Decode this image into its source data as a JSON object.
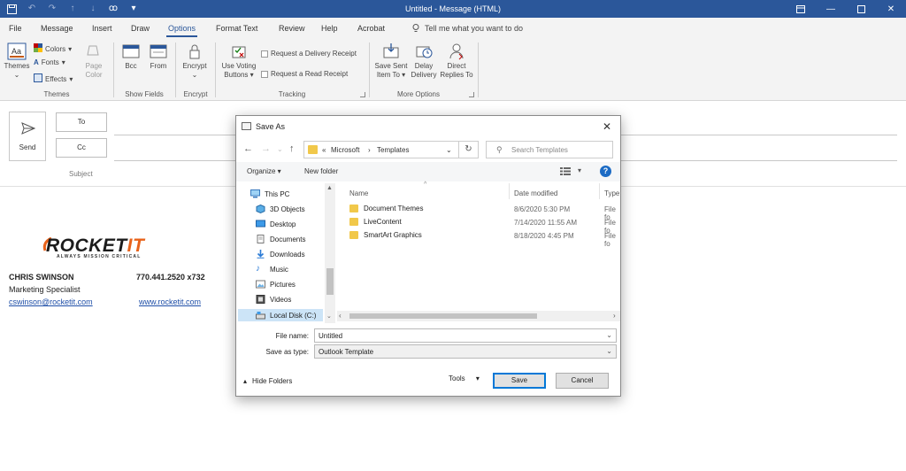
{
  "titlebar": {
    "title": "Untitled  -  Message (HTML)",
    "icons": [
      "save-icon",
      "undo-icon",
      "redo-icon",
      "up-icon",
      "down-icon",
      "paint-icon",
      "customize-icon"
    ]
  },
  "menu": {
    "tabs": [
      "File",
      "Message",
      "Insert",
      "Draw",
      "Options",
      "Format Text",
      "Review",
      "Help",
      "Acrobat"
    ],
    "active": "Options",
    "tell_me": "Tell me what you want to do"
  },
  "ribbon": {
    "themes": {
      "themes_label": "Themes",
      "colors_label": "Colors",
      "fonts_label": "Fonts",
      "effects_label": "Effects",
      "page_color_line1": "Page",
      "page_color_line2": "Color",
      "group": "Themes"
    },
    "show_fields": {
      "bcc_label": "Bcc",
      "from_label": "From",
      "group": "Show Fields"
    },
    "encrypt": {
      "encrypt_label": "Encrypt",
      "group": "Encrypt"
    },
    "tracking": {
      "voting_line1": "Use Voting",
      "voting_line2": "Buttons",
      "delivery_receipt": "Request a Delivery Receipt",
      "read_receipt": "Request a Read Receipt",
      "group": "Tracking"
    },
    "more_options": {
      "save_sent_line1": "Save Sent",
      "save_sent_line2": "Item To",
      "delay_line1": "Delay",
      "delay_line2": "Delivery",
      "direct_line1": "Direct",
      "direct_line2": "Replies To",
      "group": "More Options"
    }
  },
  "compose": {
    "send_label": "Send",
    "to_label": "To",
    "cc_label": "Cc",
    "subject_label": "Subject"
  },
  "signature": {
    "logo_text_main": "ROCKET",
    "logo_text_accent": "IT",
    "logo_tagline": "ALWAYS MISSION CRITICAL",
    "name": "CHRIS SWINSON",
    "title": "Marketing Specialist",
    "phone": "770.441.2520 x732",
    "email": "cswinson@rocketit.com",
    "website": "www.rocketit.com"
  },
  "dialog": {
    "title": "Save As",
    "breadcrumb": [
      "«",
      "Microsoft",
      "›",
      "Templates"
    ],
    "search_placeholder": "Search Templates",
    "toolbar": {
      "organize": "Organize ▾",
      "new_folder": "New folder"
    },
    "nav": [
      "This PC",
      "3D Objects",
      "Desktop",
      "Documents",
      "Downloads",
      "Music",
      "Pictures",
      "Videos",
      "Local Disk (C:)"
    ],
    "nav_selected": "Local Disk (C:)",
    "columns": {
      "name": "Name",
      "date": "Date modified",
      "type": "Type"
    },
    "files": [
      {
        "name": "Document Themes",
        "date": "8/6/2020 5:30 PM",
        "type": "File fo"
      },
      {
        "name": "LiveContent",
        "date": "7/14/2020 11:55 AM",
        "type": "File fo"
      },
      {
        "name": "SmartArt Graphics",
        "date": "8/18/2020 4:45 PM",
        "type": "File fo"
      }
    ],
    "file_name_label": "File name:",
    "file_name_value": "Untitled",
    "save_type_label": "Save as type:",
    "save_type_value": "Outlook Template",
    "hide_folders": "Hide Folders",
    "tools": "Tools",
    "save": "Save",
    "cancel": "Cancel"
  },
  "colors": {
    "titlebar": "#2b579a",
    "accent": "#2b579a",
    "logo_accent": "#e8621a",
    "link": "#1f4fa8",
    "folder": "#f1c84a",
    "selection": "#cce4f7"
  }
}
